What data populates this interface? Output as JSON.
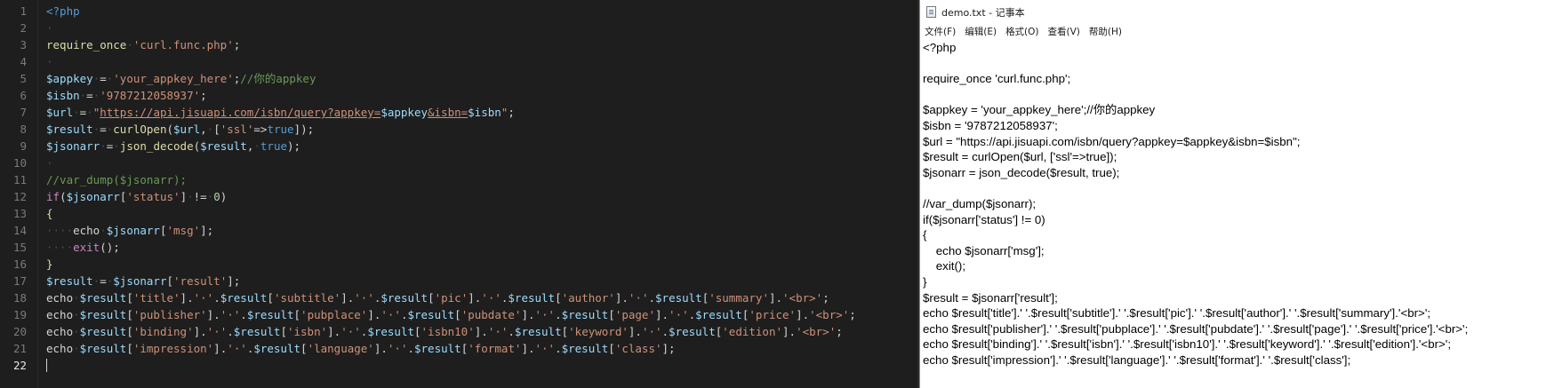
{
  "editor": {
    "current_line": 22,
    "lines": [
      [
        [
          "tag",
          "<?php"
        ]
      ],
      [
        [
          "dot",
          "·"
        ]
      ],
      [
        [
          "fn",
          "require_once"
        ],
        [
          "dot",
          "·"
        ],
        [
          "str",
          "'curl.func.php'"
        ],
        [
          "pl",
          ";"
        ]
      ],
      [
        [
          "dot",
          "·"
        ]
      ],
      [
        [
          "var",
          "$appkey"
        ],
        [
          "dot",
          "·"
        ],
        [
          "pl",
          "="
        ],
        [
          "dot",
          "·"
        ],
        [
          "str",
          "'your_appkey_here'"
        ],
        [
          "pl",
          ";"
        ],
        [
          "com",
          "//你的appkey"
        ]
      ],
      [
        [
          "var",
          "$isbn"
        ],
        [
          "dot",
          "·"
        ],
        [
          "pl",
          "="
        ],
        [
          "dot",
          "·"
        ],
        [
          "str",
          "'9787212058937'"
        ],
        [
          "pl",
          ";"
        ]
      ],
      [
        [
          "var",
          "$url"
        ],
        [
          "dot",
          "·"
        ],
        [
          "pl",
          "="
        ],
        [
          "dot",
          "·"
        ],
        [
          "str",
          "\""
        ],
        [
          "url",
          "https://api.jisuapi.com/isbn/query?appkey="
        ],
        [
          "var",
          "$appkey"
        ],
        [
          "url",
          "&isbn="
        ],
        [
          "var",
          "$isbn"
        ],
        [
          "str",
          "\""
        ],
        [
          "pl",
          ";"
        ]
      ],
      [
        [
          "var",
          "$result"
        ],
        [
          "dot",
          "·"
        ],
        [
          "pl",
          "="
        ],
        [
          "dot",
          "·"
        ],
        [
          "fn",
          "curlOpen"
        ],
        [
          "pl",
          "("
        ],
        [
          "var",
          "$url"
        ],
        [
          "pl",
          ","
        ],
        [
          "dot",
          "·"
        ],
        [
          "pl",
          "["
        ],
        [
          "str",
          "'ssl'"
        ],
        [
          "pl",
          "=>"
        ],
        [
          "bool",
          "true"
        ],
        [
          "pl",
          "]);"
        ]
      ],
      [
        [
          "var",
          "$jsonarr"
        ],
        [
          "dot",
          "·"
        ],
        [
          "pl",
          "="
        ],
        [
          "dot",
          "·"
        ],
        [
          "fn",
          "json_decode"
        ],
        [
          "pl",
          "("
        ],
        [
          "var",
          "$result"
        ],
        [
          "pl",
          ","
        ],
        [
          "dot",
          "·"
        ],
        [
          "bool",
          "true"
        ],
        [
          "pl",
          ");"
        ]
      ],
      [
        [
          "dot",
          "·"
        ]
      ],
      [
        [
          "com",
          "//var_dump($jsonarr);"
        ]
      ],
      [
        [
          "kw",
          "if"
        ],
        [
          "pl",
          "("
        ],
        [
          "var",
          "$jsonarr"
        ],
        [
          "pl",
          "["
        ],
        [
          "str",
          "'status'"
        ],
        [
          "pl",
          "]"
        ],
        [
          "dot",
          "·"
        ],
        [
          "pl",
          "!="
        ],
        [
          "dot",
          "·"
        ],
        [
          "num",
          "0"
        ],
        [
          "pl",
          ")"
        ]
      ],
      [
        [
          "fn",
          "{"
        ]
      ],
      [
        [
          "dot",
          "····"
        ],
        [
          "ink",
          "echo"
        ],
        [
          "dot",
          "·"
        ],
        [
          "var",
          "$jsonarr"
        ],
        [
          "pl",
          "["
        ],
        [
          "str",
          "'msg'"
        ],
        [
          "pl",
          "];"
        ]
      ],
      [
        [
          "dot",
          "····"
        ],
        [
          "kw",
          "exit"
        ],
        [
          "pl",
          "();"
        ]
      ],
      [
        [
          "fn",
          "}"
        ]
      ],
      [
        [
          "var",
          "$result"
        ],
        [
          "dot",
          "·"
        ],
        [
          "pl",
          "="
        ],
        [
          "dot",
          "·"
        ],
        [
          "var",
          "$jsonarr"
        ],
        [
          "pl",
          "["
        ],
        [
          "str",
          "'result'"
        ],
        [
          "pl",
          "];"
        ]
      ],
      [
        [
          "ink",
          "echo"
        ],
        [
          "dot",
          "·"
        ],
        [
          "var",
          "$result"
        ],
        [
          "pl",
          "["
        ],
        [
          "str",
          "'title'"
        ],
        [
          "pl",
          "]."
        ],
        [
          "str",
          "'·'"
        ],
        [
          "pl",
          "."
        ],
        [
          "var",
          "$result"
        ],
        [
          "pl",
          "["
        ],
        [
          "str",
          "'subtitle'"
        ],
        [
          "pl",
          "]."
        ],
        [
          "str",
          "'·'"
        ],
        [
          "pl",
          "."
        ],
        [
          "var",
          "$result"
        ],
        [
          "pl",
          "["
        ],
        [
          "str",
          "'pic'"
        ],
        [
          "pl",
          "]."
        ],
        [
          "str",
          "'·'"
        ],
        [
          "pl",
          "."
        ],
        [
          "var",
          "$result"
        ],
        [
          "pl",
          "["
        ],
        [
          "str",
          "'author'"
        ],
        [
          "pl",
          "]."
        ],
        [
          "str",
          "'·'"
        ],
        [
          "pl",
          "."
        ],
        [
          "var",
          "$result"
        ],
        [
          "pl",
          "["
        ],
        [
          "str",
          "'summary'"
        ],
        [
          "pl",
          "]."
        ],
        [
          "str",
          "'<br>'"
        ],
        [
          "pl",
          ";"
        ]
      ],
      [
        [
          "ink",
          "echo"
        ],
        [
          "dot",
          "·"
        ],
        [
          "var",
          "$result"
        ],
        [
          "pl",
          "["
        ],
        [
          "str",
          "'publisher'"
        ],
        [
          "pl",
          "]."
        ],
        [
          "str",
          "'·'"
        ],
        [
          "pl",
          "."
        ],
        [
          "var",
          "$result"
        ],
        [
          "pl",
          "["
        ],
        [
          "str",
          "'pubplace'"
        ],
        [
          "pl",
          "]."
        ],
        [
          "str",
          "'·'"
        ],
        [
          "pl",
          "."
        ],
        [
          "var",
          "$result"
        ],
        [
          "pl",
          "["
        ],
        [
          "str",
          "'pubdate'"
        ],
        [
          "pl",
          "]."
        ],
        [
          "str",
          "'·'"
        ],
        [
          "pl",
          "."
        ],
        [
          "var",
          "$result"
        ],
        [
          "pl",
          "["
        ],
        [
          "str",
          "'page'"
        ],
        [
          "pl",
          "]."
        ],
        [
          "str",
          "'·'"
        ],
        [
          "pl",
          "."
        ],
        [
          "var",
          "$result"
        ],
        [
          "pl",
          "["
        ],
        [
          "str",
          "'price'"
        ],
        [
          "pl",
          "]."
        ],
        [
          "str",
          "'<br>'"
        ],
        [
          "pl",
          ";"
        ]
      ],
      [
        [
          "ink",
          "echo"
        ],
        [
          "dot",
          "·"
        ],
        [
          "var",
          "$result"
        ],
        [
          "pl",
          "["
        ],
        [
          "str",
          "'binding'"
        ],
        [
          "pl",
          "]."
        ],
        [
          "str",
          "'·'"
        ],
        [
          "pl",
          "."
        ],
        [
          "var",
          "$result"
        ],
        [
          "pl",
          "["
        ],
        [
          "str",
          "'isbn'"
        ],
        [
          "pl",
          "]."
        ],
        [
          "str",
          "'·'"
        ],
        [
          "pl",
          "."
        ],
        [
          "var",
          "$result"
        ],
        [
          "pl",
          "["
        ],
        [
          "str",
          "'isbn10'"
        ],
        [
          "pl",
          "]."
        ],
        [
          "str",
          "'·'"
        ],
        [
          "pl",
          "."
        ],
        [
          "var",
          "$result"
        ],
        [
          "pl",
          "["
        ],
        [
          "str",
          "'keyword'"
        ],
        [
          "pl",
          "]."
        ],
        [
          "str",
          "'·'"
        ],
        [
          "pl",
          "."
        ],
        [
          "var",
          "$result"
        ],
        [
          "pl",
          "["
        ],
        [
          "str",
          "'edition'"
        ],
        [
          "pl",
          "]."
        ],
        [
          "str",
          "'<br>'"
        ],
        [
          "pl",
          ";"
        ]
      ],
      [
        [
          "ink",
          "echo"
        ],
        [
          "dot",
          "·"
        ],
        [
          "var",
          "$result"
        ],
        [
          "pl",
          "["
        ],
        [
          "str",
          "'impression'"
        ],
        [
          "pl",
          "]."
        ],
        [
          "str",
          "'·'"
        ],
        [
          "pl",
          "."
        ],
        [
          "var",
          "$result"
        ],
        [
          "pl",
          "["
        ],
        [
          "str",
          "'language'"
        ],
        [
          "pl",
          "]."
        ],
        [
          "str",
          "'·'"
        ],
        [
          "pl",
          "."
        ],
        [
          "var",
          "$result"
        ],
        [
          "pl",
          "["
        ],
        [
          "str",
          "'format'"
        ],
        [
          "pl",
          "]."
        ],
        [
          "str",
          "'·'"
        ],
        [
          "pl",
          "."
        ],
        [
          "var",
          "$result"
        ],
        [
          "pl",
          "["
        ],
        [
          "str",
          "'class'"
        ],
        [
          "pl",
          "];"
        ]
      ],
      []
    ]
  },
  "notepad": {
    "title": "demo.txt - 记事本",
    "menu": [
      "文件(F)",
      "编辑(E)",
      "格式(O)",
      "查看(V)",
      "帮助(H)"
    ],
    "lines": [
      "<?php",
      "",
      "require_once 'curl.func.php';",
      "",
      "$appkey = 'your_appkey_here';//你的appkey",
      "$isbn = '9787212058937';",
      "$url = \"https://api.jisuapi.com/isbn/query?appkey=$appkey&isbn=$isbn\";",
      "$result = curlOpen($url, ['ssl'=>true]);",
      "$jsonarr = json_decode($result, true);",
      "",
      "//var_dump($jsonarr);",
      "if($jsonarr['status'] != 0)",
      "{",
      "    echo $jsonarr['msg'];",
      "    exit();",
      "}",
      "$result = $jsonarr['result'];",
      "echo $result['title'].' '.$result['subtitle'].' '.$result['pic'].' '.$result['author'].' '.$result['summary'].'<br>';",
      "echo $result['publisher'].' '.$result['pubplace'].' '.$result['pubdate'].' '.$result['page'].' '.$result['price'].'<br>';",
      "echo $result['binding'].' '.$result['isbn'].' '.$result['isbn10'].' '.$result['keyword'].' '.$result['edition'].'<br>';",
      "echo $result['impression'].' '.$result['language'].' '.$result['format'].' '.$result['class'];"
    ]
  }
}
